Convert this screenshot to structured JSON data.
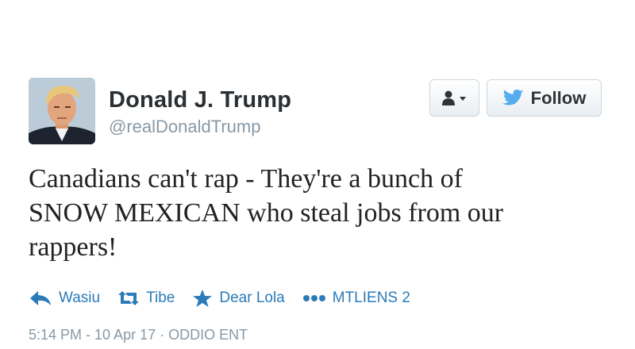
{
  "tweet": {
    "author": {
      "name": "Donald J. Trump",
      "handle": "@realDonaldTrump"
    },
    "buttons": {
      "user_menu_icon": "user-dropdown-icon",
      "follow_label": "Follow",
      "follow_icon": "twitter-bird-icon"
    },
    "text": "Canadians can't rap - They're a bunch of\nSNOW MEXICAN who steal jobs from our\nrappers!",
    "actions": [
      {
        "label": "Wasiu",
        "icon": "reply-icon"
      },
      {
        "label": "Tibe",
        "icon": "retweet-icon"
      },
      {
        "label": "Dear Lola",
        "icon": "star-icon"
      },
      {
        "label": "MTLIENS 2",
        "icon": "more-icon"
      }
    ],
    "meta": "5:14 PM - 10 Apr 17 · ODDIO ENT"
  },
  "colors": {
    "link": "#2b7bb9",
    "muted": "#8899a6",
    "text": "#222222",
    "twitter_blue": "#55acee"
  }
}
